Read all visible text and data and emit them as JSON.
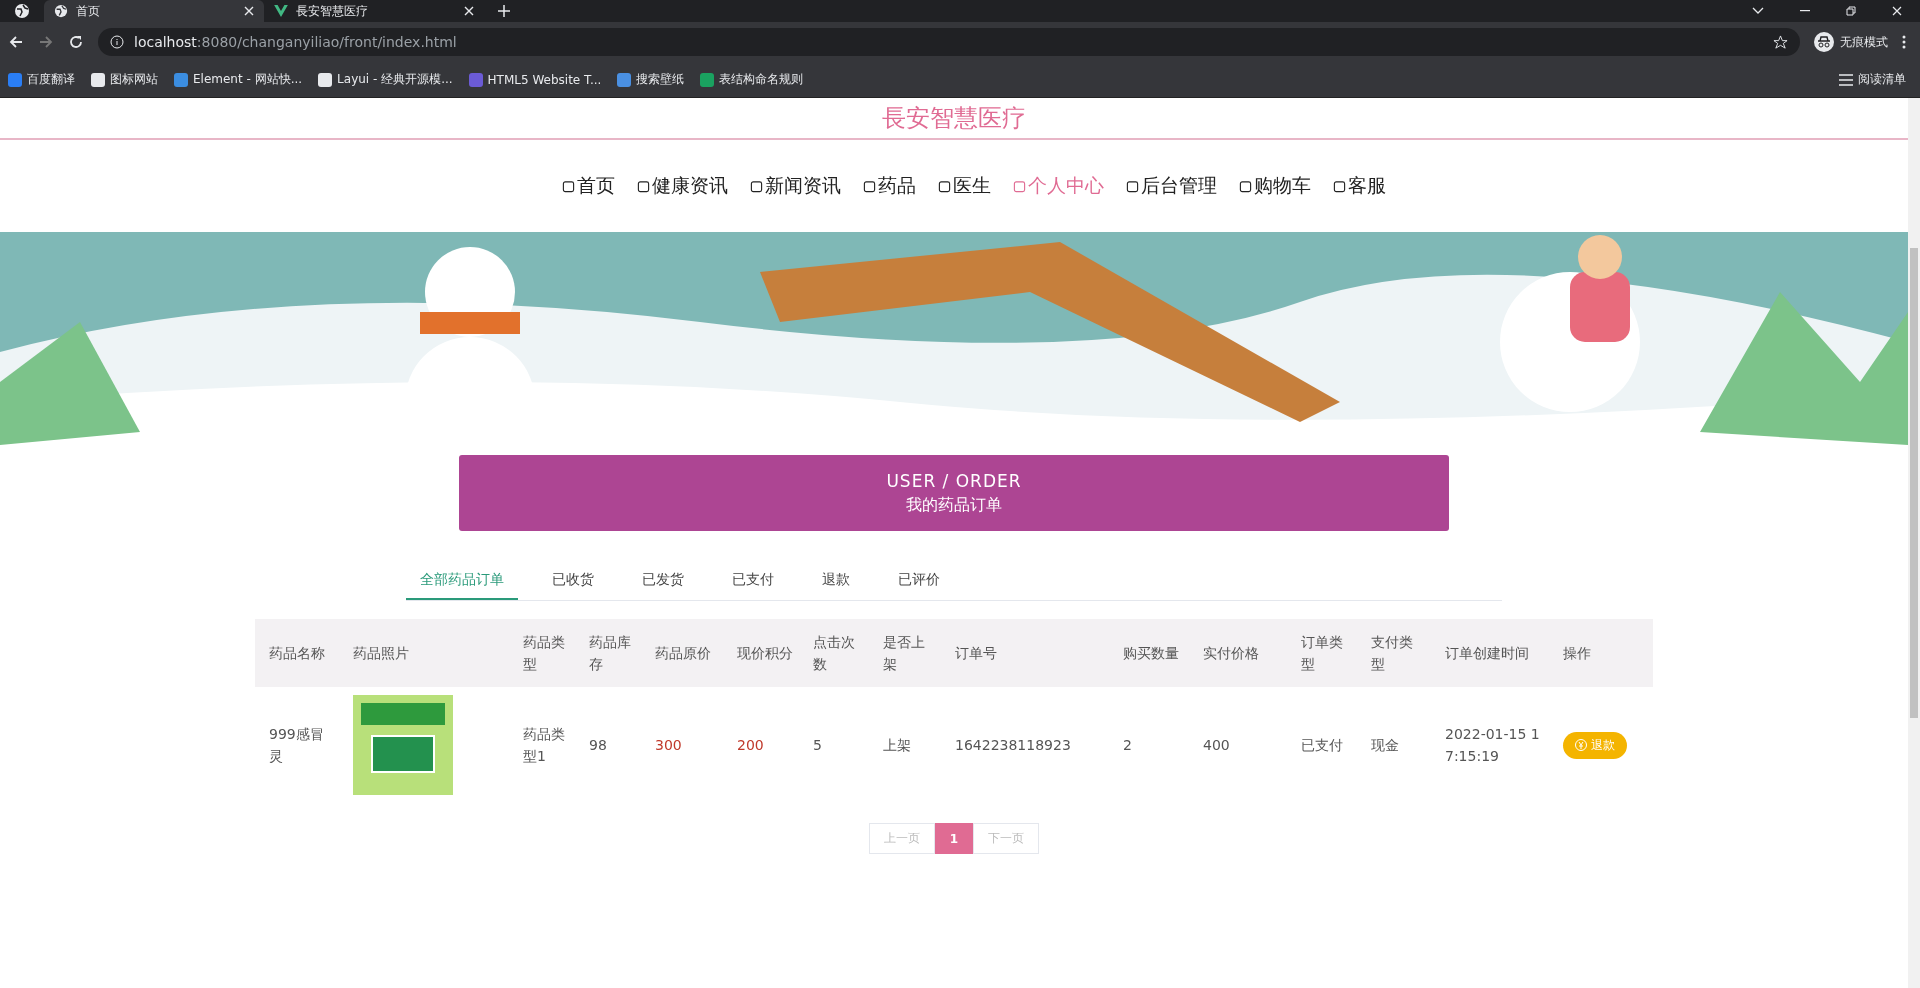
{
  "browser": {
    "tabs": [
      {
        "title": "首页",
        "selected": true
      },
      {
        "title": "長安智慧医疗",
        "selected": false
      }
    ],
    "url_host": "localhost",
    "url_rest": ":8080/changanyiliao/front/index.html",
    "incognito": "无痕模式",
    "bookmarks": [
      "百度翻译",
      "图标网站",
      "Element - 网站快...",
      "Layui - 经典开源模...",
      "HTML5 Website T...",
      "搜索壁纸",
      "表结构命名规则"
    ],
    "reading_list": "阅读清单"
  },
  "site_title": "長安智慧医疗",
  "nav": [
    {
      "label": "首页",
      "selected": false
    },
    {
      "label": "健康资讯",
      "selected": false
    },
    {
      "label": "新闻资讯",
      "selected": false
    },
    {
      "label": "药品",
      "selected": false
    },
    {
      "label": "医生",
      "selected": false
    },
    {
      "label": "个人中心",
      "selected": true
    },
    {
      "label": "后台管理",
      "selected": false
    },
    {
      "label": "购物车",
      "selected": false
    },
    {
      "label": "客服",
      "selected": false
    }
  ],
  "banner": {
    "title": "USER / ORDER",
    "subtitle": "我的药品订单"
  },
  "order_tabs": [
    {
      "label": "全部药品订单",
      "selected": true
    },
    {
      "label": "已收货",
      "selected": false
    },
    {
      "label": "已发货",
      "selected": false
    },
    {
      "label": "已支付",
      "selected": false
    },
    {
      "label": "退款",
      "selected": false
    },
    {
      "label": "已评价",
      "selected": false
    }
  ],
  "table": {
    "columns": [
      "药品名称",
      "药品照片",
      "药品类型",
      "药品库存",
      "药品原价",
      "现价积分",
      "点击次数",
      "是否上架",
      "订单号",
      "购买数量",
      "实付价格",
      "订单类型",
      "支付类型",
      "订单创建时间",
      "操作"
    ],
    "rows": [
      {
        "cells": [
          {
            "kind": "text",
            "text": "999感冒灵"
          },
          {
            "kind": "photo"
          },
          {
            "kind": "text",
            "text": "药品类型1"
          },
          {
            "kind": "text",
            "text": "98"
          },
          {
            "kind": "price",
            "text": "300"
          },
          {
            "kind": "price",
            "text": "200"
          },
          {
            "kind": "text",
            "text": "5"
          },
          {
            "kind": "text",
            "text": "上架"
          },
          {
            "kind": "text",
            "text": "1642238118923"
          },
          {
            "kind": "text",
            "text": "2"
          },
          {
            "kind": "text",
            "text": "400"
          },
          {
            "kind": "text",
            "text": "已支付"
          },
          {
            "kind": "text",
            "text": "现金"
          },
          {
            "kind": "text",
            "text": "2022-01-15 17:15:19"
          },
          {
            "kind": "button",
            "text": "退款"
          }
        ]
      }
    ]
  },
  "pagination": {
    "prev": "上一页",
    "pages": [
      {
        "label": "1",
        "selected": true
      }
    ],
    "next": "下一页"
  }
}
